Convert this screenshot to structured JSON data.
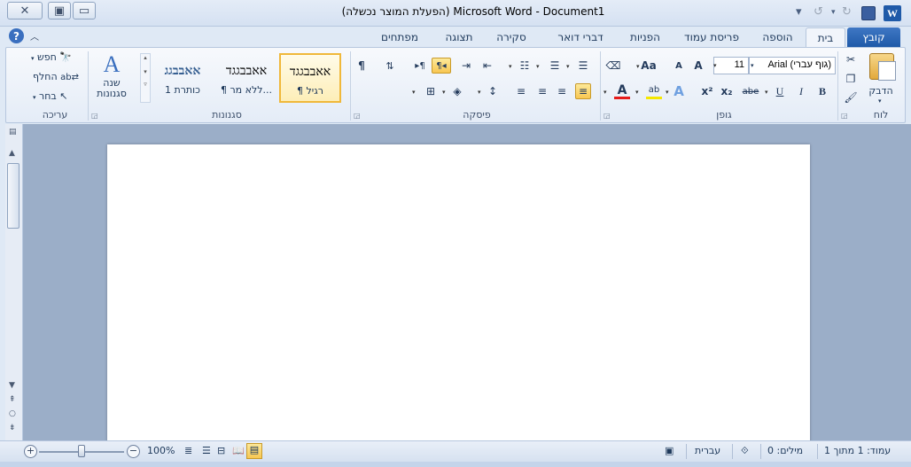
{
  "titlebar": {
    "document_title": "(הפעלת המוצר נכשלה) Microsoft Word - Document1",
    "app_icon_letter": "W"
  },
  "tabs": {
    "file": "קובץ",
    "home": "בית",
    "insert": "הוספה",
    "layout": "פריסת עמוד",
    "references": "הפניות",
    "mailings": "דברי דואר",
    "review": "סקירה",
    "view": "תצוגה",
    "developer": "מפתחים"
  },
  "ribbon": {
    "clipboard": {
      "group_label": "לוח",
      "paste_label": "הדבק"
    },
    "font": {
      "group_label": "גופן",
      "font_name": "(גוף עברי) Arial",
      "font_size": "11",
      "bold": "B",
      "italic": "I",
      "underline": "U",
      "strikethrough": "abe",
      "subscript": "x₂",
      "superscript": "x²",
      "grow": "A",
      "shrink": "A",
      "change_case": "Aa",
      "font_color": "A",
      "highlight": "ab"
    },
    "paragraph": {
      "group_label": "פיסקה",
      "show_marks": "¶",
      "rtl": "¶◂",
      "ltr": "▸¶"
    },
    "styles": {
      "group_label": "סגנונות",
      "items": [
        {
          "sample": "אאבבגגד",
          "name": "¶ רגיל"
        },
        {
          "sample": "אאבבגגד",
          "name": "¶ ללא מר..."
        },
        {
          "sample": "אאבבגג",
          "name": "כותרת 1"
        }
      ],
      "change_styles": "שנה סגנונות"
    },
    "editing": {
      "group_label": "עריכה",
      "find": "חפש",
      "replace": "החלף",
      "select": "בחר"
    }
  },
  "statusbar": {
    "page": "עמוד: 1 מתוך 1",
    "words": "מילים: 0",
    "language": "עברית",
    "zoom": "100%"
  }
}
